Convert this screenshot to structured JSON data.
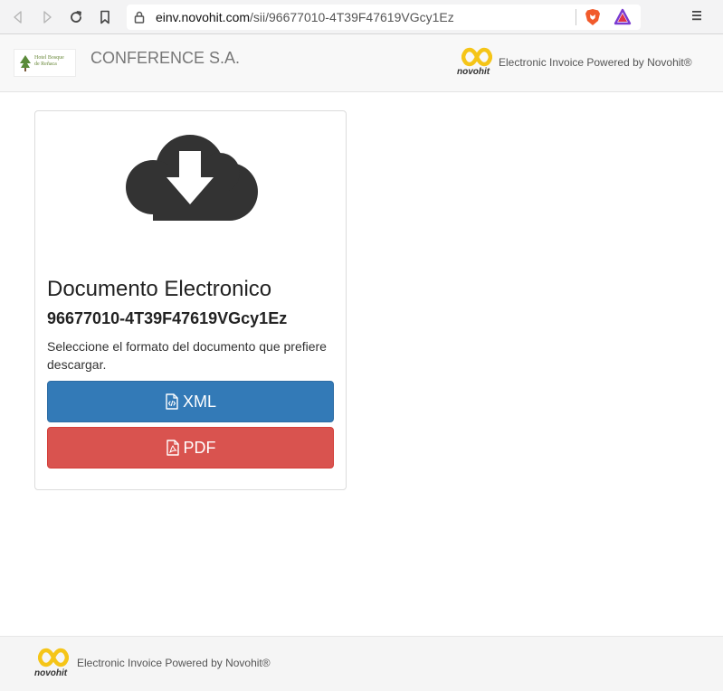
{
  "browser": {
    "url_domain": "einv.novohit.com",
    "url_path": "/sii/96677010-4T39F47619VGcy1Ez",
    "icons": [
      "back-icon",
      "forward-icon",
      "reload-icon",
      "bookmark-icon",
      "lock-icon",
      "brave-shields-icon",
      "brave-rewards-icon",
      "menu-icon"
    ]
  },
  "header": {
    "hotel_logo_text_line1": "Hotel Bosque",
    "hotel_logo_text_line2": "de Reñaca",
    "company_name": "CONFERENCE S.A.",
    "novohit_wordmark": "novohit",
    "powered_by": "Electronic Invoice Powered by Novohit®"
  },
  "card": {
    "icon": "cloud-download-icon",
    "title": "Documento Electronico",
    "document_id": "96677010-4T39F47619VGcy1Ez",
    "instructions": "Seleccione el formato del documento que prefiere descargar.",
    "xml_button_label": "XML",
    "pdf_button_label": "PDF"
  },
  "footer": {
    "novohit_wordmark": "novohit",
    "powered_by": "Electronic Invoice Powered by Novohit®"
  },
  "colors": {
    "xml_button": "#337ab7",
    "pdf_button": "#d9534f",
    "novohit_yellow": "#f5c518",
    "cloud_icon": "#333333"
  }
}
